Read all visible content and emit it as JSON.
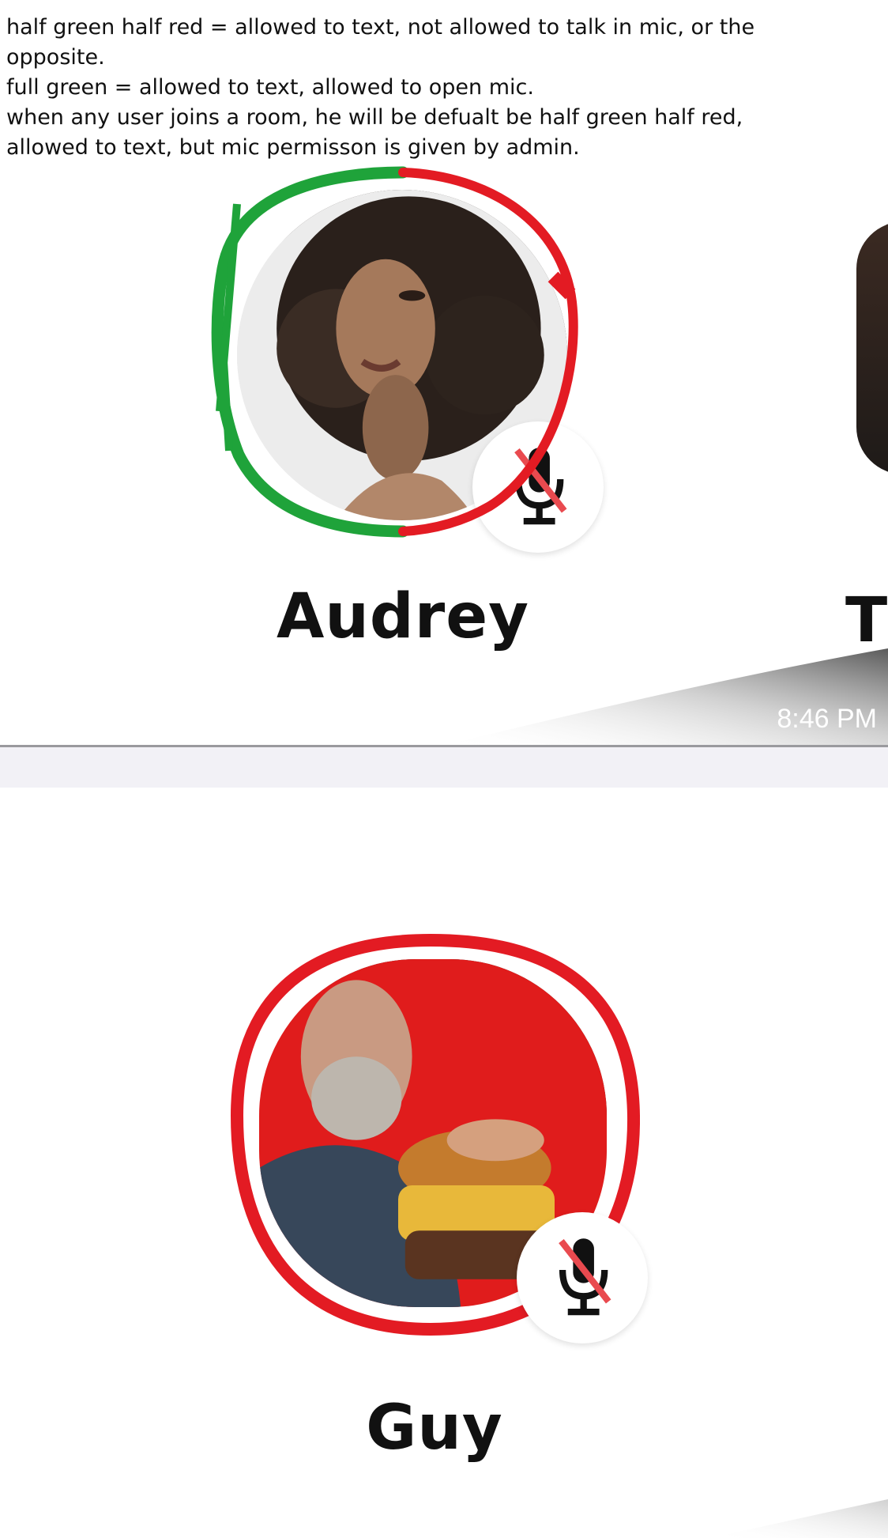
{
  "notes": {
    "line1": "half green half red = allowed to text, not allowed to talk in mic, or the",
    "line2": "opposite.",
    "line3": "full green = allowed to text, allowed to open mic.",
    "line4": "when any user joins a room, he will be defualt be half green half red,",
    "line5": "allowed to text, but mic permisson is given by admin."
  },
  "top_panel": {
    "participant": {
      "name": "Audrey",
      "mic_state": "muted",
      "icon": "mic-muted-icon",
      "ring_colors": {
        "left": "#1fa33a",
        "right": "#e31b23"
      }
    },
    "next_participant_initial": "T",
    "timestamp": "8:46 PM"
  },
  "bottom_panel": {
    "participant": {
      "name": "Guy",
      "mic_state": "muted",
      "icon": "mic-muted-icon",
      "ring_color": "#e31b23"
    }
  },
  "colors": {
    "green": "#1fa33a",
    "red": "#e31b23",
    "separator": "#9a9a9e",
    "gap": "#f2f1f6"
  }
}
